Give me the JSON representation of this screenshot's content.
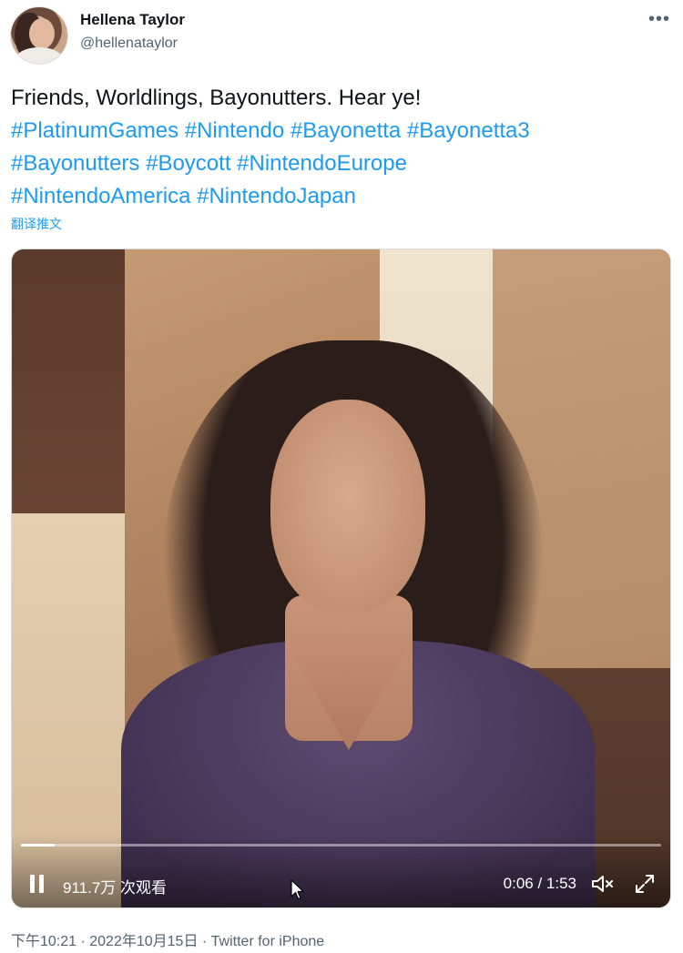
{
  "author": {
    "display_name": "Hellena Taylor",
    "handle": "@hellenataylor"
  },
  "menu_icon": "more-horizontal-icon",
  "tweet": {
    "lines": [
      [
        "Friends, Worldlings, Bayonutters. Hear ye!"
      ],
      [
        "#PlatinumGames",
        "#Nintendo",
        "#Bayonetta",
        "#Bayonetta3"
      ],
      [
        "#Bayonutters",
        "#Boycott",
        "#NintendoEurope"
      ],
      [
        "#NintendoAmerica",
        "#NintendoJapan"
      ]
    ],
    "text": "Friends, Worldlings, Bayonutters. Hear ye!",
    "hashtags": [
      "#PlatinumGames",
      "#Nintendo",
      "#Bayonetta",
      "#Bayonetta3",
      "#Bayonutters",
      "#Boycott",
      "#NintendoEurope",
      "#NintendoAmerica",
      "#NintendoJapan"
    ],
    "translate_label": "翻译推文"
  },
  "video": {
    "views": "911.7万 次观看",
    "time": "0:06 / 1:53",
    "progress_fraction": 0.053,
    "controls_icons": [
      "pause-icon",
      "volume-icon",
      "fullscreen-icon"
    ]
  },
  "meta": {
    "text": "下午10:21 · 2022年10月15日 · Twitter for iPhone"
  },
  "colors": {
    "link": "#1d9bf0",
    "secondary_text": "#536471",
    "primary_text": "#0f1419"
  }
}
